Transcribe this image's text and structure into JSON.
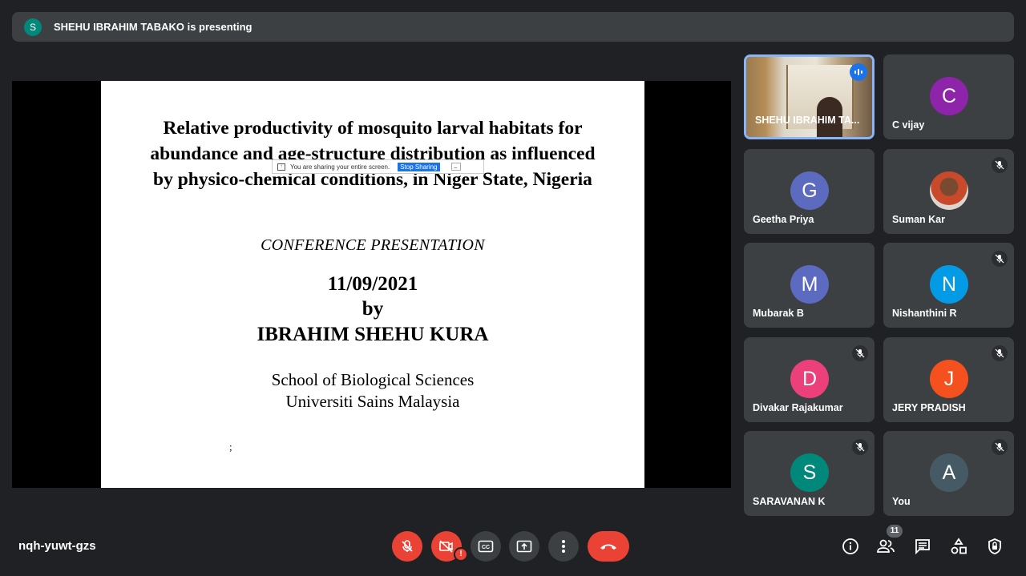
{
  "banner": {
    "avatar_letter": "S",
    "text": "SHEHU IBRAHIM TABAKO is presenting"
  },
  "slide": {
    "title_lines": [
      "Relative productivity of mosquito larval habitats for",
      "abundance and age-structure distribution as influenced",
      "by physico-chemical conditions,  in Niger State, Nigeria"
    ],
    "conference": "CONFERENCE  PRESENTATION",
    "date": "11/09/2021",
    "by": "by",
    "author": "IBRAHIM SHEHU KURA",
    "school": "School of Biological Sciences",
    "university": "Universiti Sains Malaysia",
    "semicolon": ";"
  },
  "share_bar": {
    "message": "You are sharing your entire screen.",
    "stop_label": "Stop Sharing",
    "min_label": "_"
  },
  "tiles": [
    {
      "name": "SHEHU IBRAHIM TA...",
      "type": "video",
      "active": true,
      "speaking": true
    },
    {
      "name": "C vijay",
      "letter": "C",
      "color": "#8e24aa",
      "muted": false
    },
    {
      "name": "Geetha Priya",
      "letter": "G",
      "color": "#5c6bc0",
      "muted": false
    },
    {
      "name": "Suman Kar",
      "type": "photo",
      "muted": true
    },
    {
      "name": "Mubarak B",
      "letter": "M",
      "color": "#5c6bc0",
      "muted": false
    },
    {
      "name": "Nishanthini R",
      "letter": "N",
      "color": "#039be5",
      "muted": true
    },
    {
      "name": "Divakar Rajakumar",
      "letter": "D",
      "color": "#ec407a",
      "muted": true
    },
    {
      "name": "JERY PRADISH",
      "letter": "J",
      "color": "#f4511e",
      "muted": true
    },
    {
      "name": "SARAVANAN K",
      "letter": "S",
      "color": "#00897b",
      "muted": true
    },
    {
      "name": "You",
      "letter": "A",
      "color": "#455a64",
      "muted": true
    }
  ],
  "bottom": {
    "meeting_code": "nqh-yuwt-gzs",
    "warning_mark": "!",
    "people_count": "11"
  },
  "colors": {
    "accent_blue": "#1a73e8",
    "danger_red": "#ea4335",
    "active_border": "#8ab4f8"
  },
  "icons": [
    "mic-off-icon",
    "camera-off-icon",
    "captions-icon",
    "present-icon",
    "more-icon",
    "end-call-icon",
    "info-icon",
    "people-icon",
    "chat-icon",
    "activities-icon",
    "host-controls-icon"
  ]
}
